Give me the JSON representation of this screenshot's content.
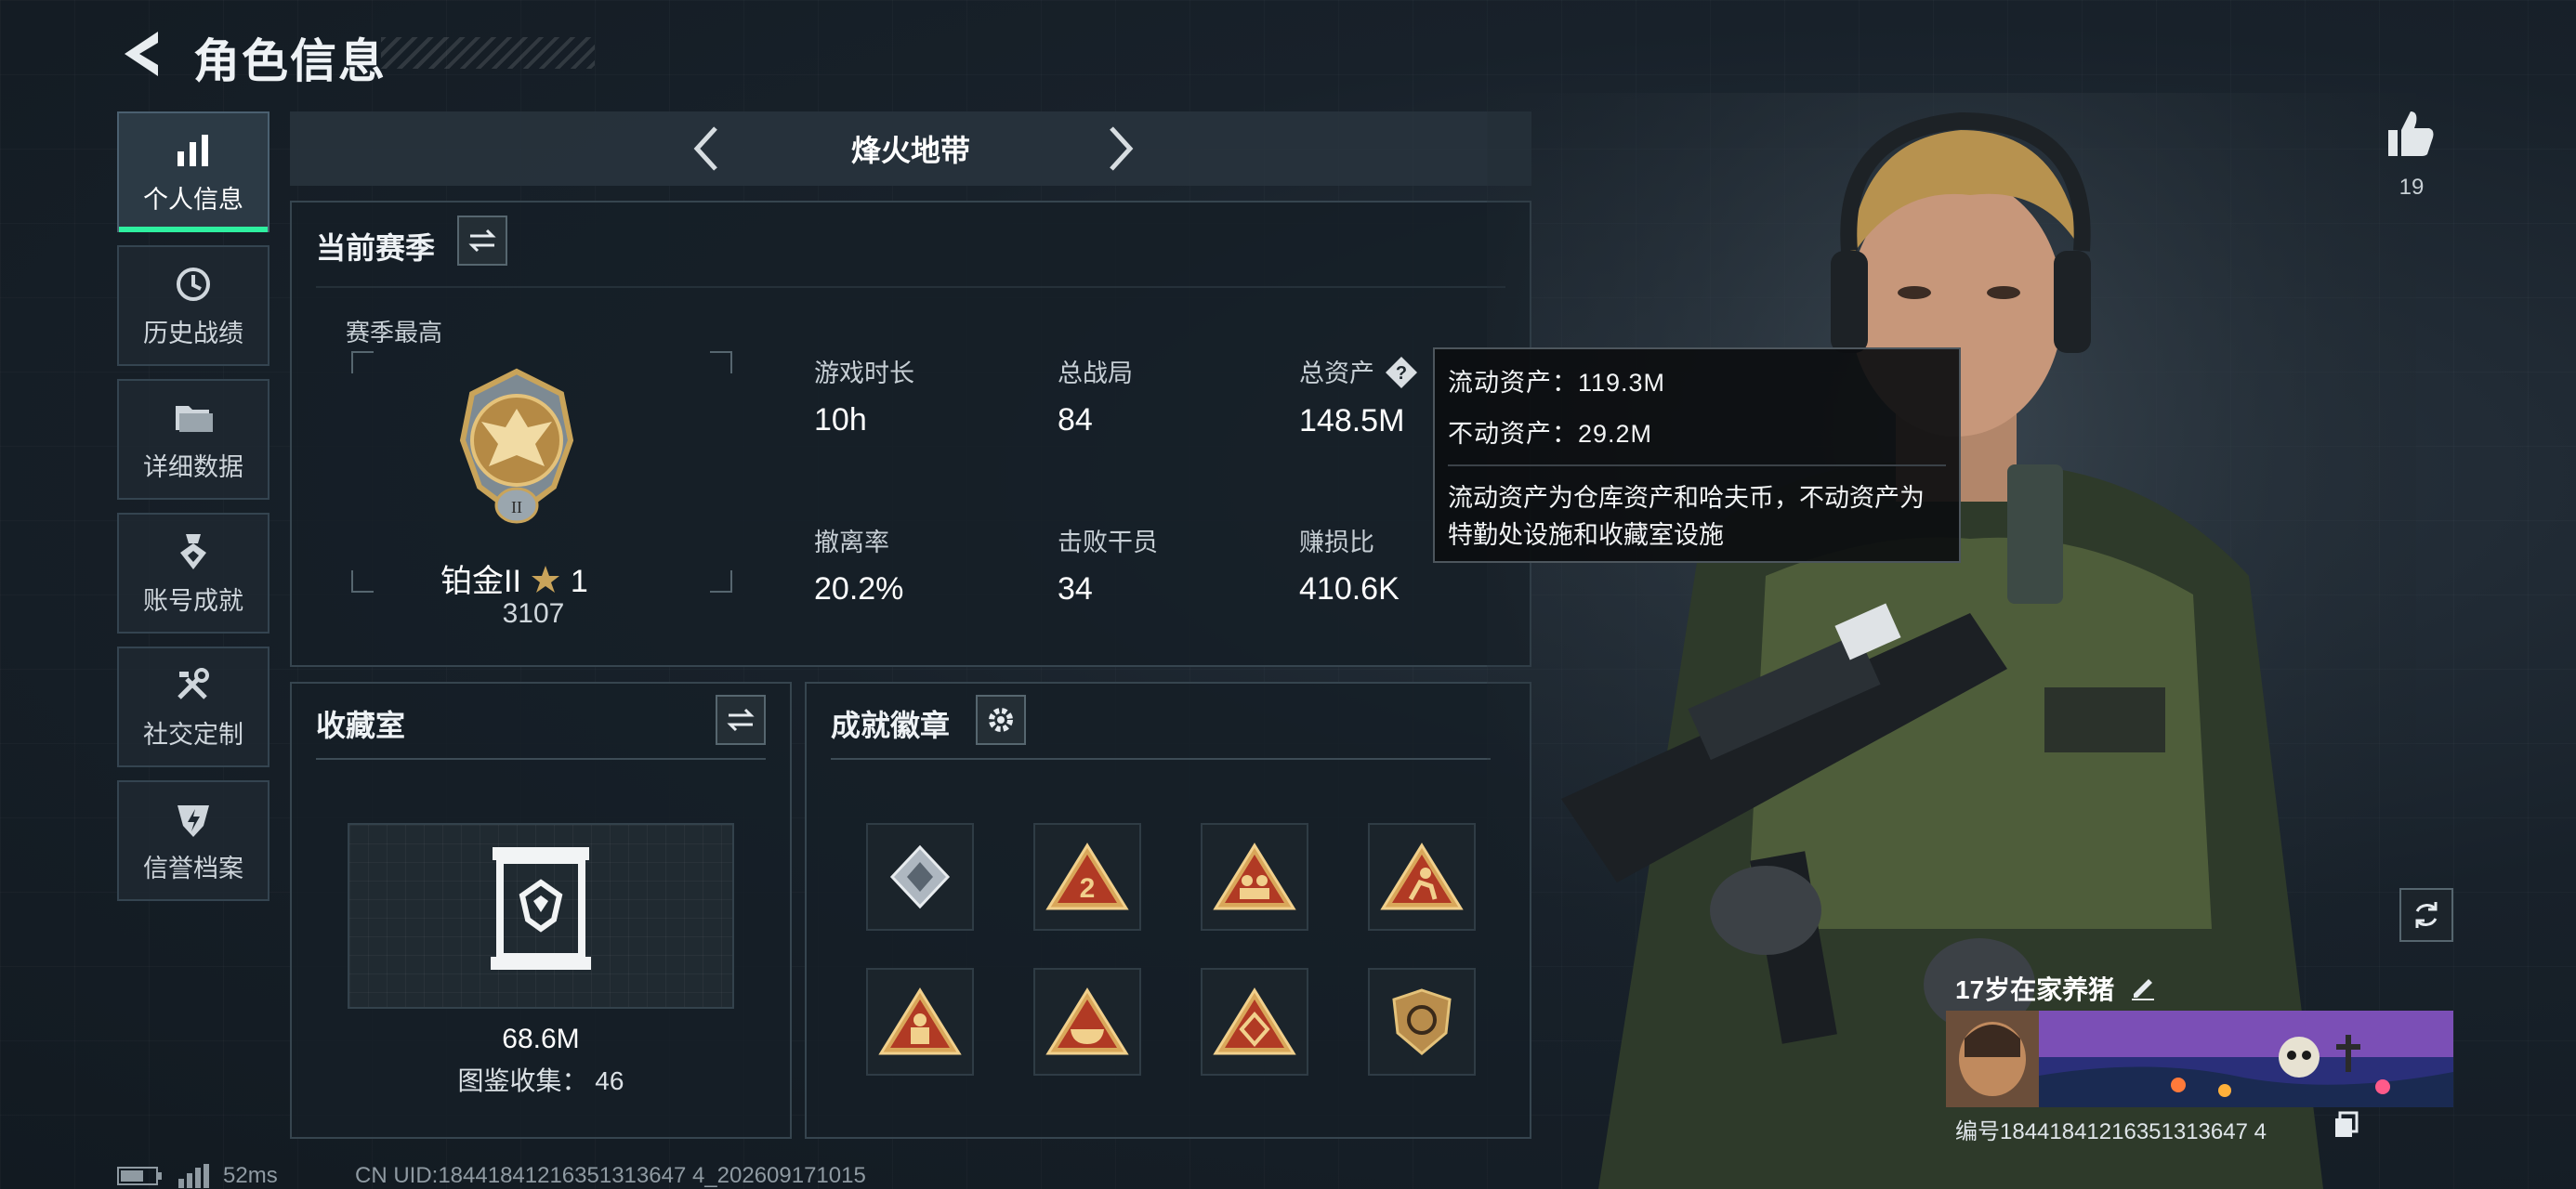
{
  "header": {
    "title": "角色信息"
  },
  "sidebar": {
    "items": [
      {
        "label": "个人信息",
        "icon": "bar-chart-icon",
        "active": true
      },
      {
        "label": "历史战绩",
        "icon": "history-clock-icon",
        "active": false
      },
      {
        "label": "详细数据",
        "icon": "folder-icon",
        "active": false
      },
      {
        "label": "账号成就",
        "icon": "medal-icon",
        "active": false
      },
      {
        "label": "社交定制",
        "icon": "tools-icon",
        "active": false
      },
      {
        "label": "信誉档案",
        "icon": "shield-bolt-icon",
        "active": false
      }
    ]
  },
  "map_selector": {
    "current": "烽火地带"
  },
  "season": {
    "title": "当前赛季",
    "subtitle": "赛季最高",
    "rank_name": "铂金II",
    "rank_stars": "1",
    "rank_score": "3107",
    "stats": [
      {
        "label": "游戏时长",
        "value": "10h"
      },
      {
        "label": "总战局",
        "value": "84"
      },
      {
        "label": "总资产",
        "value": "148.5M"
      },
      {
        "label": "撤离率",
        "value": "20.2%"
      },
      {
        "label": "击败干员",
        "value": "34"
      },
      {
        "label": "赚损比",
        "value": "410.6K"
      }
    ]
  },
  "tooltip": {
    "liquid_label": "流动资产：",
    "liquid_value": "119.3M",
    "fixed_label": "不动资产：",
    "fixed_value": "29.2M",
    "description": "流动资产为仓库资产和哈夫币，不动资产为特勤处设施和收藏室设施"
  },
  "collection": {
    "title": "收藏室",
    "value": "68.6M",
    "count_text": "图鉴收集：  46"
  },
  "achievements": {
    "title": "成就徽章",
    "badges": [
      "cube-badge-icon",
      "number-two-badge-icon",
      "team-badge-icon",
      "runner-badge-icon",
      "soldier-badge-icon",
      "bowl-badge-icon",
      "diamond-badge-icon",
      "shield-badge-icon"
    ]
  },
  "status_bar": {
    "ping": "52ms",
    "uid": "CN UID:18441841216351313647 4_202609171015"
  },
  "profile": {
    "likes": "19",
    "player_name": "17岁在家养猪",
    "player_id": "编号18441841216351313647 4"
  },
  "colors": {
    "accent": "#2ef0a0",
    "panel": "#161f27",
    "border": "#36454f",
    "gold": "#c9a45a"
  }
}
